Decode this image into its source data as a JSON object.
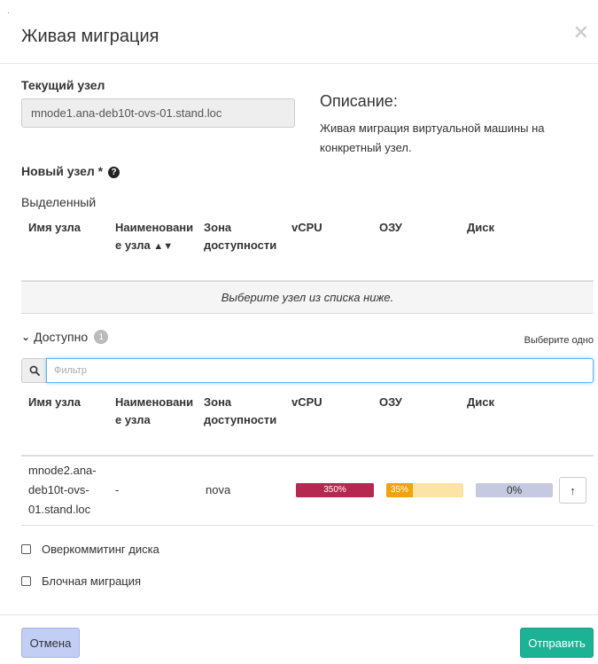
{
  "corner_mark": "·",
  "modal": {
    "title": "Живая миграция",
    "close_icon": "times-icon"
  },
  "current_node": {
    "label": "Текущий узел",
    "value": "mnode1.ana-deb10t-ovs-01.stand.loc"
  },
  "description": {
    "title": "Описание:",
    "text": "Живая миграция виртуальной машины на конкретный узел."
  },
  "new_node": {
    "label": "Новый узел",
    "required": "*",
    "help_icon": "question-circle-icon"
  },
  "allocated": {
    "label": "Выделенный",
    "columns": [
      "Имя узла",
      "Наименование узла",
      "Зона доступности",
      "vCPU",
      "ОЗУ",
      "Диск"
    ],
    "column_lines": {
      "name": "Имя узла",
      "title_line1": "Наименовани",
      "title_line2": "е узла",
      "zone_line1": "Зона",
      "zone_line2": "доступности",
      "vcpu": "vCPU",
      "ram": "ОЗУ",
      "disk": "Диск"
    },
    "empty_text": "Выберите узел из списка ниже."
  },
  "available": {
    "label": "Доступно",
    "count": "1",
    "select_hint": "Выберите одно",
    "filter_placeholder": "Фильтр",
    "column_lines": {
      "name": "Имя узла",
      "title_line1": "Наименовани",
      "title_line2": "е узла",
      "zone_line1": "Зона",
      "zone_line2": "доступности",
      "vcpu": "vCPU",
      "ram": "ОЗУ",
      "disk": "Диск"
    },
    "rows": [
      {
        "name_line1": "mnode2.ana-",
        "name_line2": "deb10t-ovs-",
        "name_line3": "01.stand.loc",
        "title": "-",
        "zone": "nova",
        "vcpu": {
          "label": "350%",
          "value": 3.5
        },
        "ram": {
          "label": "35%",
          "value": 0.35
        },
        "disk": {
          "label": "0%",
          "value": 0
        }
      }
    ]
  },
  "options": {
    "disk_overcommit": "Оверкоммитинг диска",
    "block_migration": "Блочная миграция"
  },
  "footer": {
    "cancel": "Отмена",
    "submit": "Отправить"
  },
  "colors": {
    "vcpu_bar": "#b5284f",
    "ram_bar": "#f0a30a",
    "ram_track": "#fce3a6",
    "disk_track": "#c5cae0",
    "submit": "#1bb394",
    "cancel": "#c3cef5"
  }
}
